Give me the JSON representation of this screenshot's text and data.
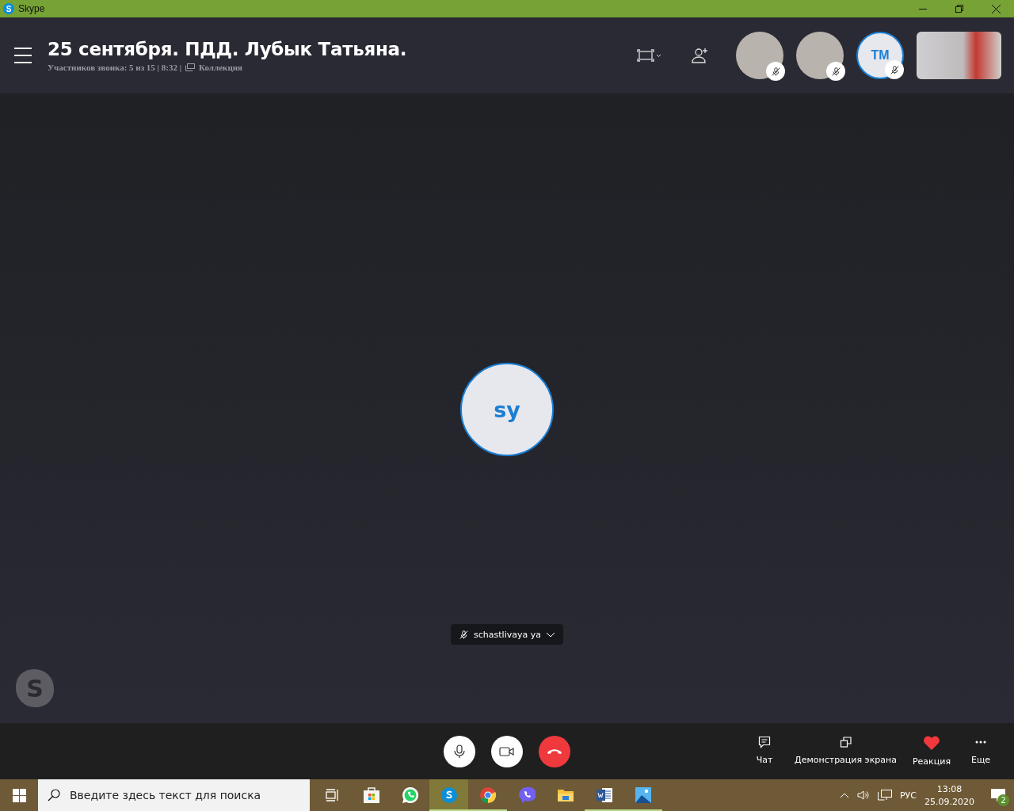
{
  "window": {
    "title": "Skype",
    "app_letter": "S"
  },
  "call_header": {
    "title": "25 сентября. ПДД. Лубык Татьяна.",
    "info": "Участников звонка: 5 из 15 | 8:32 |",
    "gallery_label": "Коллекция"
  },
  "participants": [
    {
      "kind": "photo",
      "muted": true
    },
    {
      "kind": "photo",
      "muted": true
    },
    {
      "kind": "initials",
      "initials": "TM",
      "muted": true
    },
    {
      "kind": "video"
    }
  ],
  "main_participant": {
    "initials": "sy",
    "name": "schastlivaya ya",
    "muted": true
  },
  "watermark_letter": "S",
  "call_controls": [
    {
      "kind": "mic"
    },
    {
      "kind": "camera"
    },
    {
      "kind": "hangup"
    }
  ],
  "actions": [
    {
      "kind": "chat",
      "label": "Чат"
    },
    {
      "kind": "share",
      "label": "Демонстрация экрана"
    },
    {
      "kind": "reaction",
      "label": "Реакция"
    },
    {
      "kind": "more",
      "label": "Еще"
    }
  ],
  "taskbar": {
    "search_placeholder": "Введите здесь текст для поиска",
    "apps": [
      {
        "kind": "taskview",
        "running": false,
        "selected": false
      },
      {
        "kind": "store",
        "running": false,
        "selected": false
      },
      {
        "kind": "whatsapp",
        "running": false,
        "selected": false
      },
      {
        "kind": "skype",
        "running": true,
        "selected": true
      },
      {
        "kind": "chrome",
        "running": true,
        "selected": false
      },
      {
        "kind": "viber",
        "running": false,
        "selected": false
      },
      {
        "kind": "explorer",
        "running": false,
        "selected": false
      },
      {
        "kind": "word",
        "running": true,
        "selected": false
      },
      {
        "kind": "photos",
        "running": true,
        "selected": false
      }
    ],
    "language": "РУС",
    "time": "13:08",
    "date": "25.09.2020",
    "notifications": "2"
  }
}
